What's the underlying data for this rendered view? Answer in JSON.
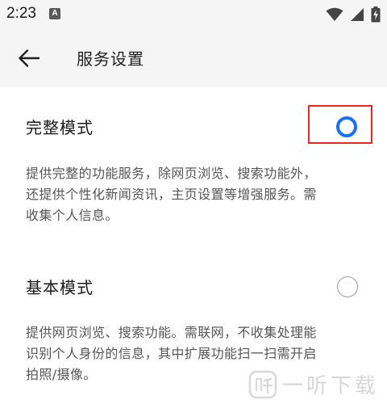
{
  "status_bar": {
    "time": "2:23",
    "notification_letter": "A"
  },
  "app_bar": {
    "title": "服务设置"
  },
  "modes": [
    {
      "label": "完整模式",
      "selected": true,
      "description": [
        "提供完整的功能服务，除网页浏览、搜索功能外，",
        "还提供个性化新闻资讯，主页设置等增强服务。需",
        "收集个人信息。"
      ]
    },
    {
      "label": "基本模式",
      "selected": false,
      "description": [
        "提供网页浏览、搜索功能。需联网，不收集处理能",
        "识别个人身份的信息，其中扩展功能扫一扫需开启",
        "拍照/摄像。"
      ]
    }
  ],
  "watermark": {
    "text": "一听下载"
  },
  "colors": {
    "accent": "#1671f5",
    "highlight": "#e8281e"
  }
}
